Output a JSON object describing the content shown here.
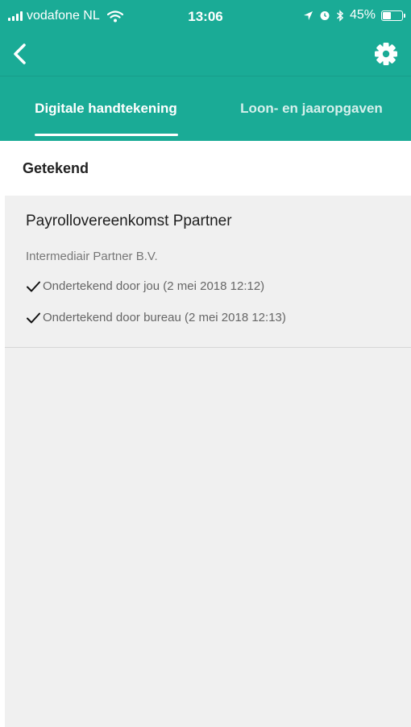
{
  "status_bar": {
    "carrier": "vodafone NL",
    "time": "13:06",
    "battery_percent": "45%",
    "battery_level": 0.45,
    "icons": [
      "signal-bars-icon",
      "wifi-icon",
      "location-icon",
      "alarm-icon",
      "bluetooth-icon",
      "battery-icon"
    ]
  },
  "nav": {
    "back_icon": "chevron-left-icon",
    "settings_icon": "gear-icon"
  },
  "tabs": [
    {
      "label": "Digitale handtekening",
      "active": true
    },
    {
      "label": "Loon- en jaaropgaven",
      "active": false
    }
  ],
  "section": {
    "title": "Getekend"
  },
  "documents": [
    {
      "title": "Payrollovereenkomst Ppartner",
      "company": "Intermediair Partner B.V.",
      "signatures": [
        "Ondertekend door jou (2 mei 2018 12:12)",
        "Ondertekend door bureau (2 mei 2018 12:13)"
      ]
    }
  ],
  "colors": {
    "header": "#1aab96",
    "background": "#f0f0f0",
    "active_tab_text": "#ffffff"
  }
}
